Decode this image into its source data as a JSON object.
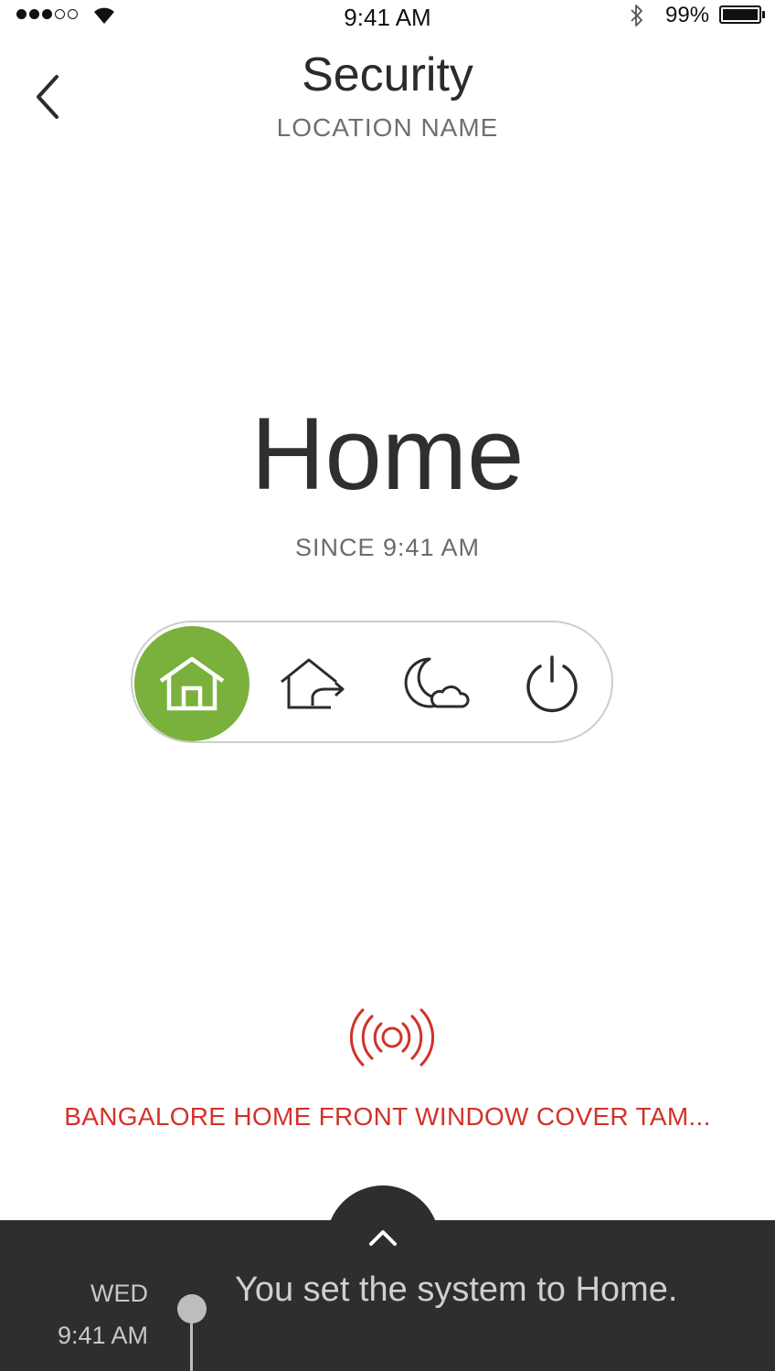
{
  "status_bar": {
    "time": "9:41 AM",
    "battery_percent": "99%",
    "signal_dots_filled": 3,
    "signal_dots_total": 5,
    "battery_level": 0.99
  },
  "header": {
    "title": "Security",
    "location": "LOCATION NAME",
    "back_icon": "chevron-left-icon"
  },
  "mode": {
    "current": "Home",
    "since": "SINCE 9:41 AM"
  },
  "mode_selector": {
    "options": [
      "home",
      "away",
      "night",
      "off"
    ],
    "selected": "home",
    "accent_color": "#7ab03c"
  },
  "alert": {
    "icon": "alarm-signal-icon",
    "text": "BANGALORE HOME FRONT WINDOW COVER TAM...",
    "color": "#d0332b"
  },
  "drawer": {
    "handle_icon": "chevron-up-icon",
    "event": {
      "day": "WED",
      "time": "9:41 AM",
      "message": "You set the system to Home."
    }
  }
}
